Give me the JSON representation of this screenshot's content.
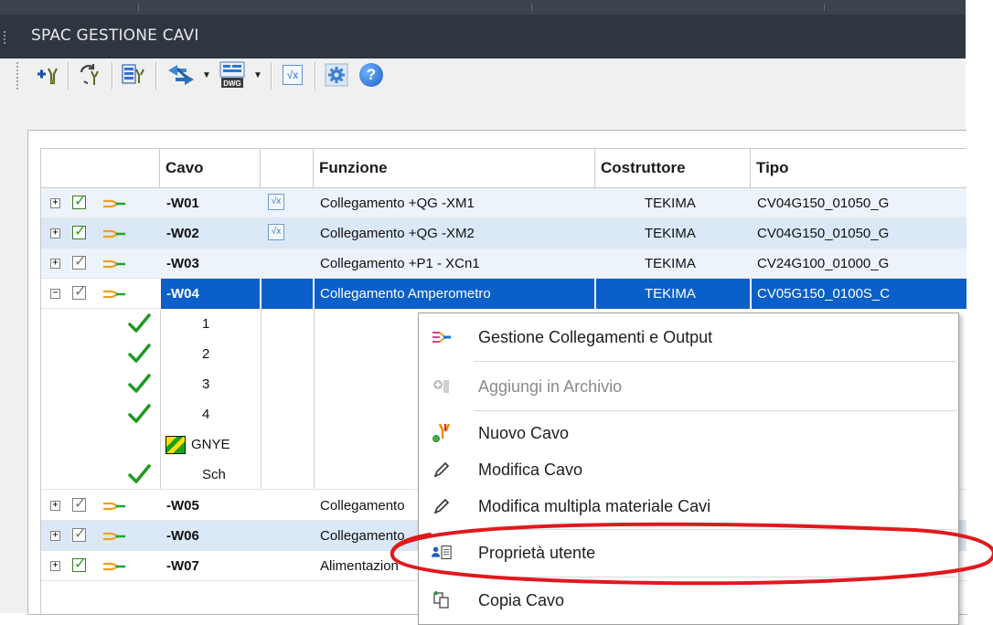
{
  "window": {
    "title": "SPAC GESTIONE CAVI"
  },
  "toolbar": {
    "buttons": [
      {
        "icon": "add-cable-icon"
      },
      {
        "icon": "refresh-cables-icon"
      },
      {
        "icon": "cable-list-icon"
      },
      {
        "icon": "swap-arrows-icon"
      },
      {
        "icon": "dwg-export-icon",
        "label": "DWG"
      },
      {
        "icon": "formula-icon",
        "label": "√x"
      },
      {
        "icon": "gear-icon"
      },
      {
        "icon": "help-icon",
        "label": "?"
      }
    ]
  },
  "table": {
    "columns": [
      "Cavo",
      "Funzione",
      "Costruttore",
      "Tipo"
    ],
    "rows": [
      {
        "expander": "+",
        "checked": true,
        "cavo": "-W01",
        "formula": "√x",
        "funzione": "Collegamento +QG -XM1",
        "costruttore": "TEKIMA",
        "tipo": "CV04G150_01050_G"
      },
      {
        "expander": "+",
        "checked": true,
        "cavo": "-W02",
        "formula": "√x",
        "funzione": "Collegamento +QG -XM2",
        "costruttore": "TEKIMA",
        "tipo": "CV04G150_01050_G"
      },
      {
        "expander": "+",
        "checked": false,
        "cavo": "-W03",
        "funzione": "Collegamento +P1 - XCn1",
        "costruttore": "TEKIMA",
        "tipo": "CV24G100_01000_G"
      },
      {
        "expander": "−",
        "checked": false,
        "cavo": "-W04",
        "funzione": "Collegamento Amperometro",
        "costruttore": "TEKIMA",
        "tipo": "CV05G150_0100S_C"
      }
    ],
    "children": [
      {
        "icon": "green-check-icon",
        "label": "1"
      },
      {
        "icon": "green-check-icon",
        "label": "2"
      },
      {
        "icon": "green-check-icon",
        "label": "3"
      },
      {
        "icon": "green-check-icon",
        "label": "4"
      },
      {
        "icon": "gnye-color-icon",
        "label": "GNYE"
      },
      {
        "icon": "green-check-icon",
        "label": "Sch"
      }
    ],
    "rows_after": [
      {
        "expander": "+",
        "checked": false,
        "cavo": "-W05",
        "funzione": "Collegamento"
      },
      {
        "expander": "+",
        "checked": false,
        "cavo": "-W06",
        "funzione": "Collegamento"
      },
      {
        "expander": "+",
        "checked": true,
        "cavo": "-W07",
        "funzione": "Alimentazion"
      }
    ]
  },
  "context_menu": {
    "items": [
      {
        "label": "Gestione Collegamenti e Output",
        "icon": "connections-icon",
        "enabled": true
      },
      {
        "label": "Aggiungi in Archivio",
        "icon": "archive-add-icon",
        "enabled": false
      },
      {
        "label": "Nuovo Cavo",
        "icon": "new-cable-icon",
        "enabled": true
      },
      {
        "label": "Modifica Cavo",
        "icon": "pencil-icon",
        "enabled": true
      },
      {
        "label": "Modifica multipla materiale Cavi",
        "icon": "pencil-icon",
        "enabled": true
      },
      {
        "label": "Proprietà utente",
        "icon": "user-properties-icon",
        "enabled": true
      },
      {
        "label": "Copia Cavo",
        "icon": "copy-icon",
        "enabled": true
      }
    ]
  },
  "colors": {
    "title_bar": "#2f3640",
    "selection": "#0a5fc9",
    "row_alt": "#edf3fb",
    "annotation": "#e0191e"
  }
}
